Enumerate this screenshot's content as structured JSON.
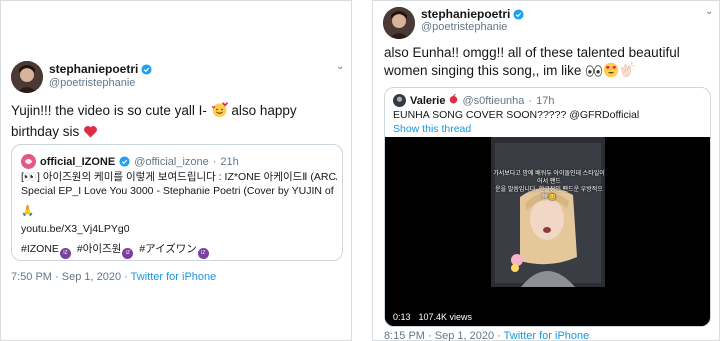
{
  "left": {
    "display_name": "stephaniepoetri",
    "handle": "@poetristephanie",
    "text_main": "Yujin!!! the video is so cute yall I-",
    "text_cont": " also happy",
    "text_line2": "birthday sis",
    "quote": {
      "name": "official_IZONE",
      "handle": "@official_izone",
      "sep": "·",
      "time": "21h",
      "line1": "[👀] 아이즈원의 케미를 이렇게 보여드립니다 : IZ*ONE 아케이드Ⅱ (ARCADE Ⅱ)",
      "line2": "Special EP_I Love You 3000 - Stephanie Poetri (Cover by YUJIN of IZ*ONE)",
      "hands": "🙏",
      "url": "youtu.be/X3_Vj4LPYg0",
      "hashtags": [
        "#IZONE",
        "#아이즈원",
        "#アイズワン"
      ]
    },
    "timestamp": "7:50 PM · Sep 1, 2020 · ",
    "source": "Twitter for iPhone",
    "menu_caret": "⌄"
  },
  "right": {
    "display_name": "stephaniepoetri",
    "handle": "@poetristephanie",
    "line1": "also Eunha!! omgg!! all of these talented beautiful",
    "line2": "women singing this song,, im like ",
    "quote": {
      "name": "Valerie",
      "handle": "@s0ftieunha",
      "sep": "·",
      "time": "17h",
      "text": "EUNHA SONG COVER SOON????? @GFRDofficial",
      "show_thread": "Show this thread",
      "video_caption_1": "가서보다고 밤에 배워두 아이돌인데 스타일이어서 팬드",
      "video_caption_2": "운을 말씀입니다. 한글장인 팬드운 우방적으 행 😊",
      "video_time": "0:13",
      "video_views": "107.4K views"
    },
    "timestamp": "8:15 PM · Sep 1, 2020 · ",
    "source": "Twitter for iPhone",
    "menu_caret": "⌄"
  },
  "colors": {
    "link_blue": "#1b95e0",
    "muted": "#657786",
    "izone_badge": "#7a3fa0"
  }
}
